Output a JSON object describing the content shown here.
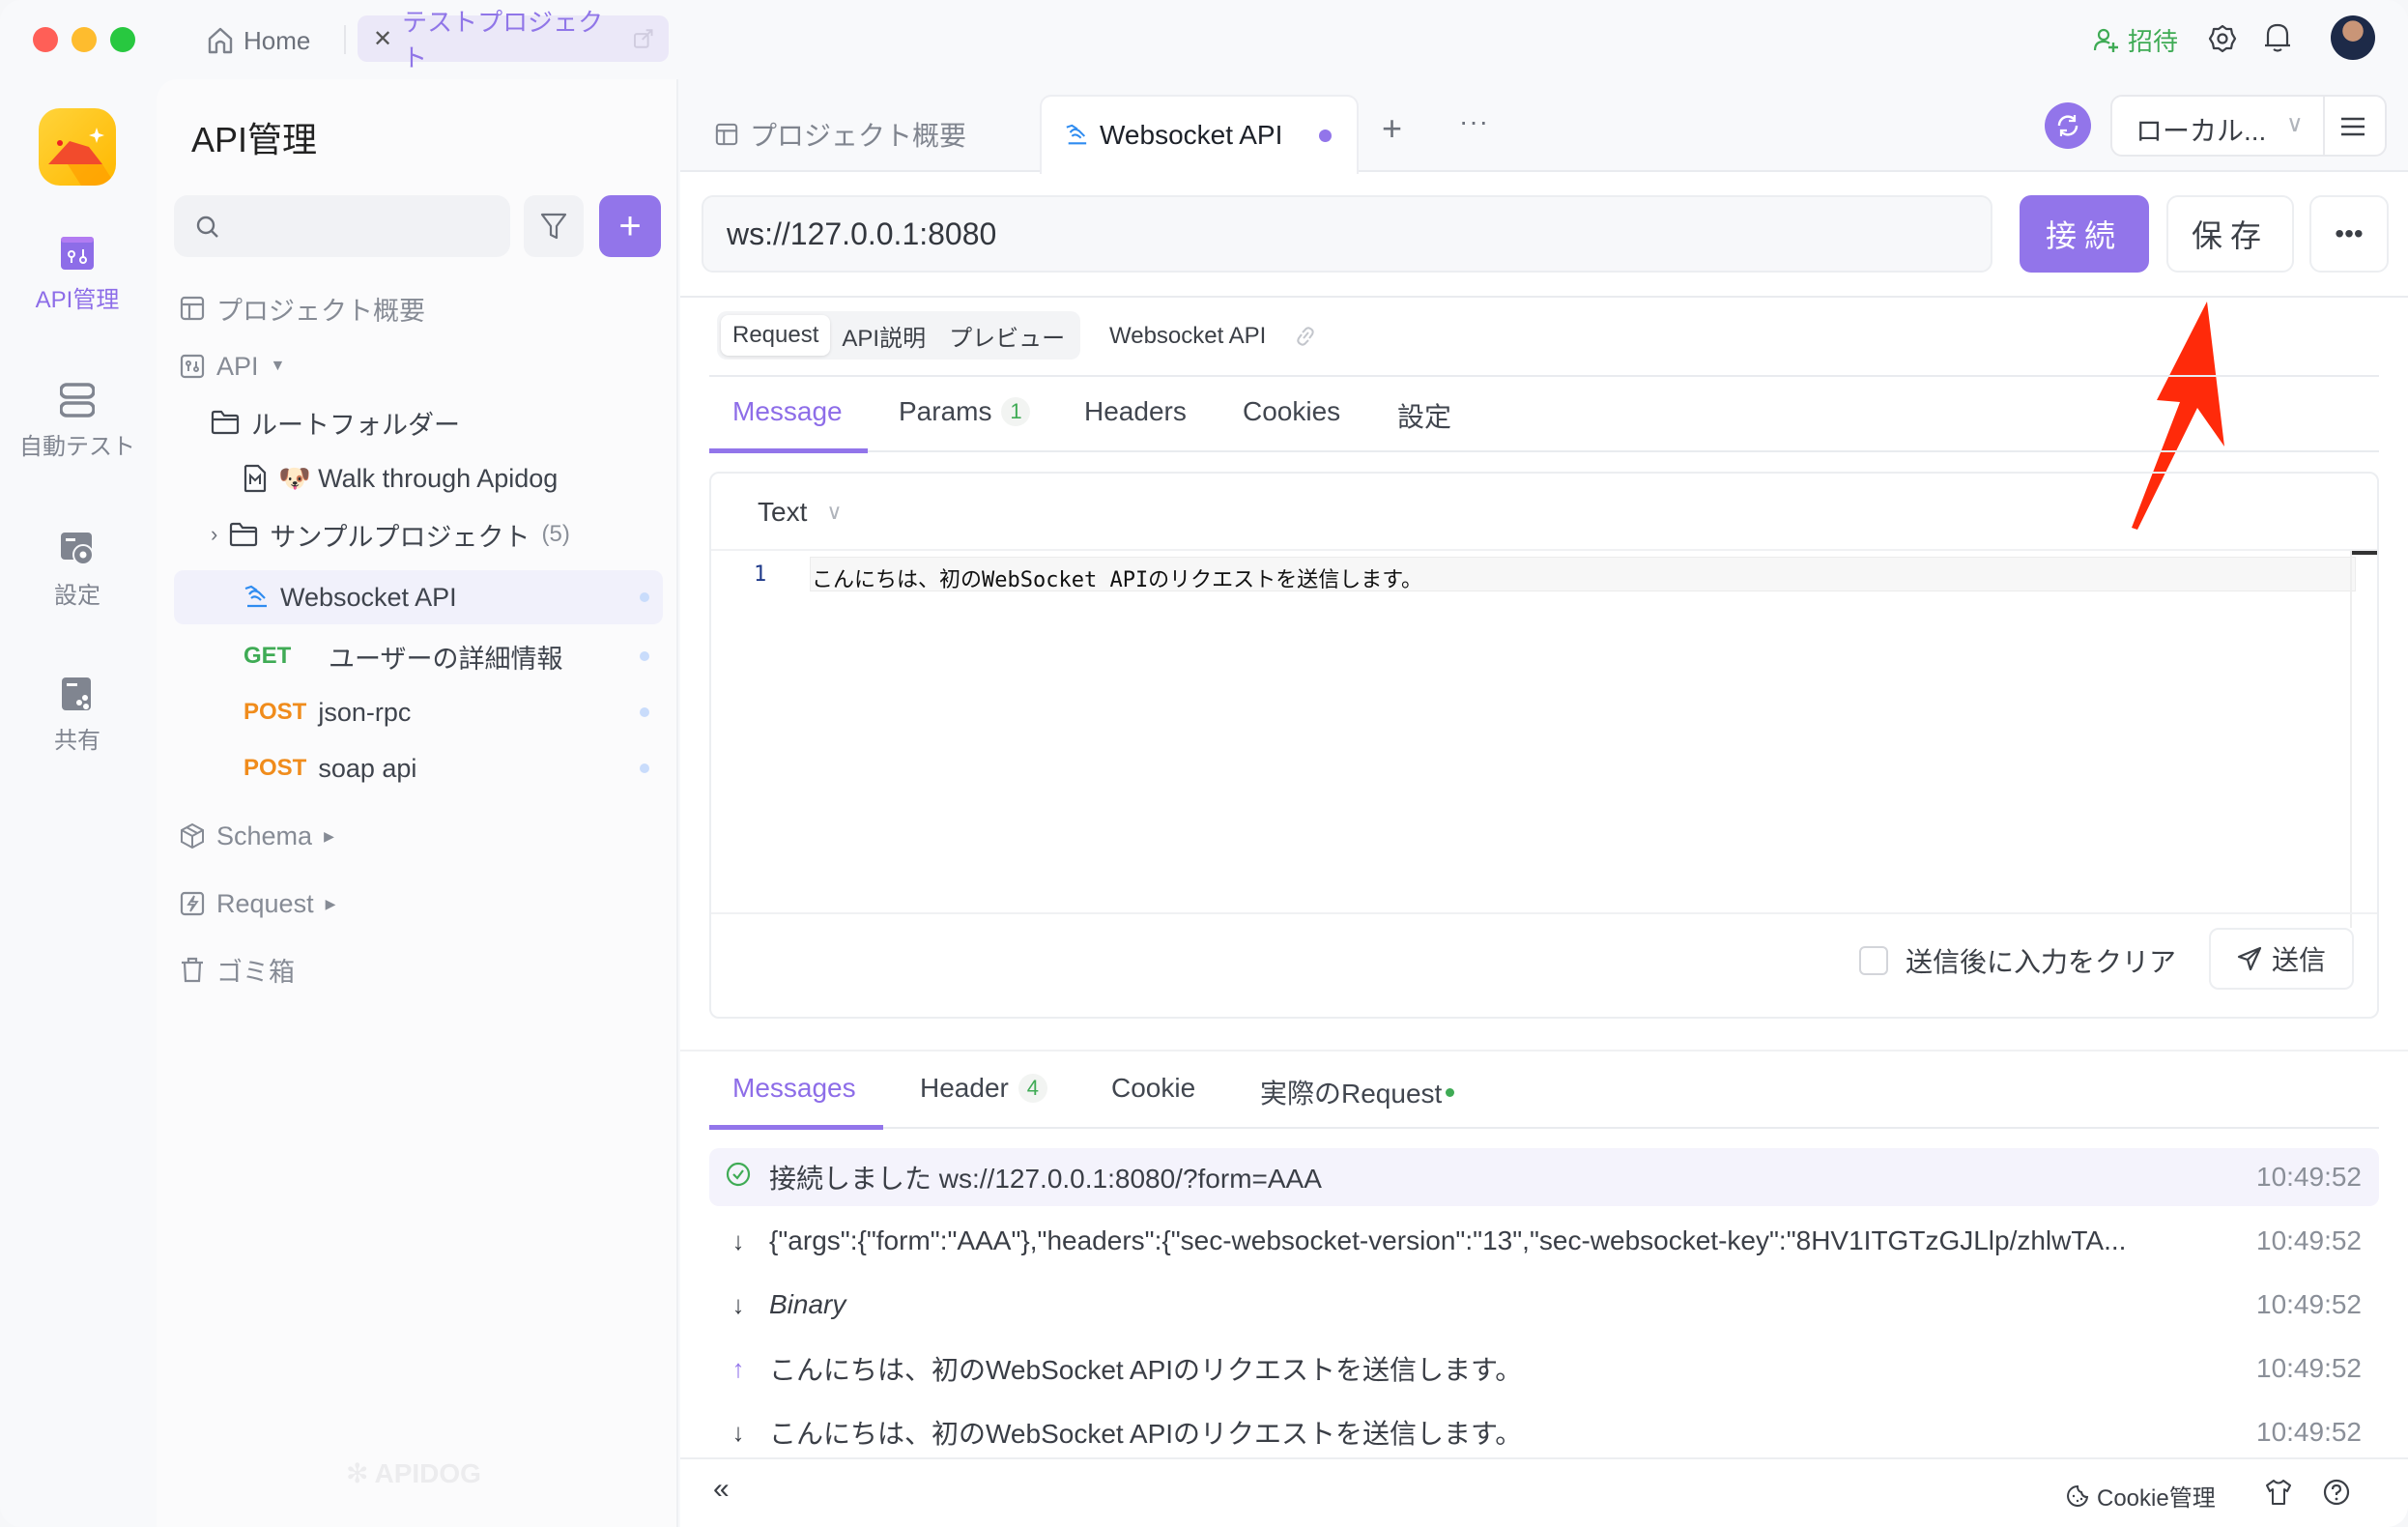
{
  "titlebar": {
    "home_label": "Home",
    "project_tab_label": "テストプロジェクト",
    "invite_label": "招待",
    "colors": {
      "accent": "#9275ea",
      "invite": "#3fab55"
    }
  },
  "rail": {
    "items": [
      {
        "label": "API管理",
        "icon": "api-icon",
        "active": true
      },
      {
        "label": "自動テスト",
        "icon": "auto-test-icon",
        "active": false
      },
      {
        "label": "設定",
        "icon": "settings-icon",
        "active": false
      },
      {
        "label": "共有",
        "icon": "share-icon",
        "active": false
      }
    ]
  },
  "sidebar": {
    "title": "API管理",
    "search_placeholder": "",
    "items": {
      "overview": "プロジェクト概要",
      "api": "API",
      "root_folder": "ルートフォルダー",
      "walkthrough": "🐶 Walk through Apidog",
      "sample_project": "サンプルプロジェクト",
      "sample_count": "(5)",
      "websocket": "Websocket API",
      "get_method": "GET",
      "get_name": "ユーザーの詳細情報",
      "post1_method": "POST",
      "post1_name": "json-rpc",
      "post2_method": "POST",
      "post2_name": "soap api",
      "schema": "Schema",
      "request": "Request",
      "trash": "ゴミ箱"
    },
    "watermark": "APIDOG"
  },
  "main": {
    "tabs": [
      {
        "label": "プロジェクト概要"
      },
      {
        "label": "Websocket API",
        "active": true
      }
    ],
    "env_label": "ローカル...",
    "url": "ws://127.0.0.1:8080",
    "connect_label": "接続",
    "save_label": "保存",
    "subtabs": [
      "Request",
      "API説明",
      "プレビュー"
    ],
    "api_name": "Websocket API",
    "param_tabs": [
      {
        "label": "Message",
        "active": true
      },
      {
        "label": "Params",
        "badge": "1"
      },
      {
        "label": "Headers"
      },
      {
        "label": "Cookies"
      },
      {
        "label": "設定"
      }
    ],
    "message_type": "Text",
    "editor_lines": [
      {
        "num": "1",
        "text": "こんにちは、初のWebSocket APIのリクエストを送信します。"
      }
    ],
    "clear_after_send_label": "送信後に入力をクリア",
    "clear_after_send_checked": false,
    "send_label": "送信",
    "response_tabs": [
      {
        "label": "Messages",
        "active": true
      },
      {
        "label": "Header",
        "badge": "4"
      },
      {
        "label": "Cookie"
      },
      {
        "label": "実際のRequest",
        "dot": true
      }
    ],
    "messages": [
      {
        "dir": "connected",
        "text": "接続しました ws://127.0.0.1:8080/?form=AAA",
        "time": "10:49:52"
      },
      {
        "dir": "down",
        "text": "{\"args\":{\"form\":\"AAA\"},\"headers\":{\"sec-websocket-version\":\"13\",\"sec-websocket-key\":\"8HV1ITGTzGJLlp/zhlwTA...",
        "time": "10:49:52"
      },
      {
        "dir": "down",
        "text": "Binary",
        "time": "10:49:52",
        "italic": true
      },
      {
        "dir": "up",
        "text": "こんにちは、初のWebSocket APIのリクエストを送信します。",
        "time": "10:49:52"
      },
      {
        "dir": "down",
        "text": "こんにちは、初のWebSocket APIのリクエストを送信します。",
        "time": "10:49:52"
      }
    ],
    "footer": {
      "cookie_label": "Cookie管理"
    }
  }
}
